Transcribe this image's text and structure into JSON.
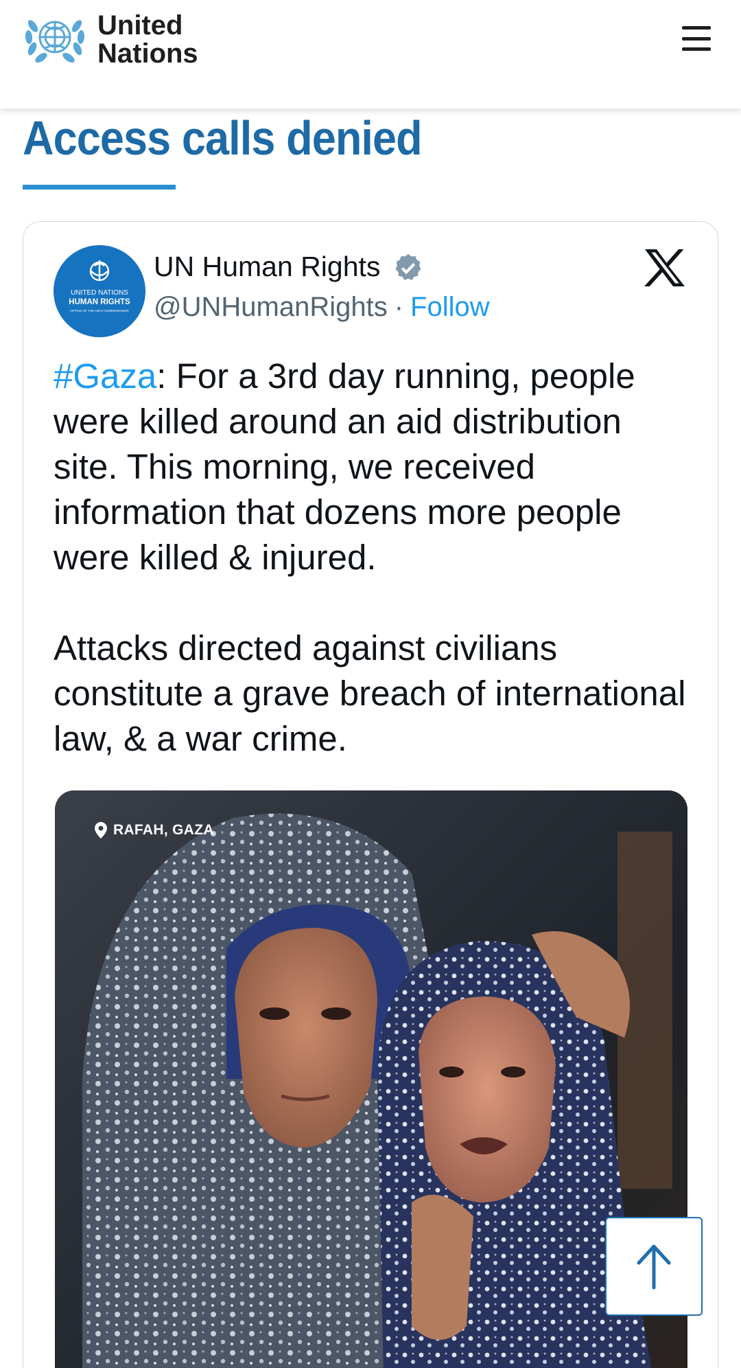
{
  "header": {
    "brand_line1": "United",
    "brand_line2": "Nations",
    "logo_icon": "un-emblem-icon",
    "menu_icon": "hamburger-menu-icon"
  },
  "article": {
    "headline": "Access calls denied"
  },
  "tweet": {
    "author_name": "UN Human Rights",
    "verified_icon": "verified-badge-icon",
    "handle": "@UNHumanRights",
    "separator": "·",
    "follow_label": "Follow",
    "platform_icon": "x-logo-icon",
    "avatar": {
      "line1": "UNITED NATIONS",
      "line2": "HUMAN RIGHTS",
      "line3": "OFFICE OF THE HIGH COMMISSIONER"
    },
    "hashtag": "#Gaza",
    "paragraph1_rest": ": For a 3rd day running, people were killed around an aid distribution site. This morning, we received information that dozens more people were killed & injured.",
    "paragraph2": "Attacks directed against civilians constitute a grave breach of international law, & a war crime.",
    "photo": {
      "location_label": "RAFAH, GAZA",
      "location_icon": "location-pin-icon"
    }
  },
  "back_to_top": {
    "icon": "arrow-up-icon"
  },
  "colors": {
    "headline": "#1d6aa6",
    "accent_rule": "#2b8fd2",
    "link": "#1d9bf0",
    "avatar_bg": "#1673c0"
  }
}
